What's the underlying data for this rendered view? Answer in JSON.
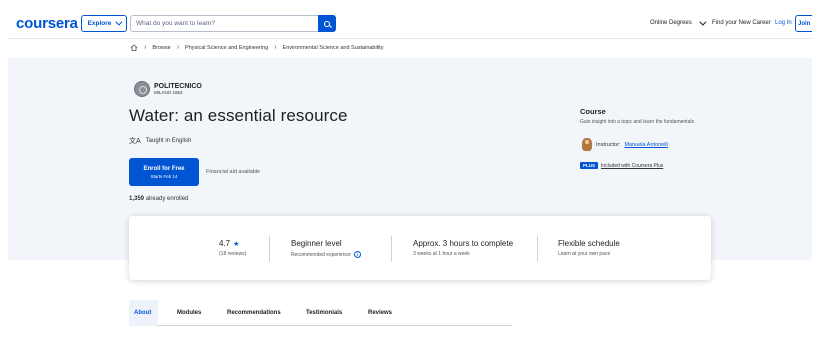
{
  "header": {
    "logo": "coursera",
    "explore_label": "Explore",
    "search_placeholder": "What do you want to learn?",
    "online_degrees": "Online Degrees",
    "new_career": "Find your New Career",
    "login": "Log In",
    "join": "Join"
  },
  "breadcrumb": {
    "items": [
      "Browse",
      "Physical Science and Engineering",
      "Environmental Science and Sustainability"
    ]
  },
  "hero": {
    "uni_name": "POLITECNICO",
    "uni_sub": "MILANO 1863",
    "title": "Water: an essential resource",
    "taught": "Taught in English",
    "enroll_main": "Enroll for Free",
    "enroll_sub": "Starts Feb 14",
    "financial_aid": "Financial aid available",
    "enrolled_count": "1,359",
    "enrolled_suffix": "already enrolled"
  },
  "side": {
    "title": "Course",
    "desc": "Gain insight into a topic and learn the fundamentals",
    "instructor_label": "Instructor:",
    "instructor_name": "Manuela Antonelli",
    "plus_badge": "PLUS",
    "plus_text": "Included with Coursera Plus"
  },
  "stats": {
    "rating": "4.7",
    "reviews": "(18 reviews)",
    "level": "Beginner level",
    "level_sub": "Recommended experience",
    "duration": "Approx. 3 hours to complete",
    "duration_sub": "3 weeks at 1 hour a week",
    "schedule": "Flexible schedule",
    "schedule_sub": "Learn at your own pace"
  },
  "tabs": [
    "About",
    "Modules",
    "Recommendations",
    "Testimonials",
    "Reviews"
  ],
  "colors": {
    "brand": "#0056d2",
    "hero_bg": "#f2f5fa"
  },
  "icons": [
    "search-icon",
    "chevron-down-icon",
    "home-icon",
    "translate-icon",
    "star-icon",
    "info-icon"
  ]
}
